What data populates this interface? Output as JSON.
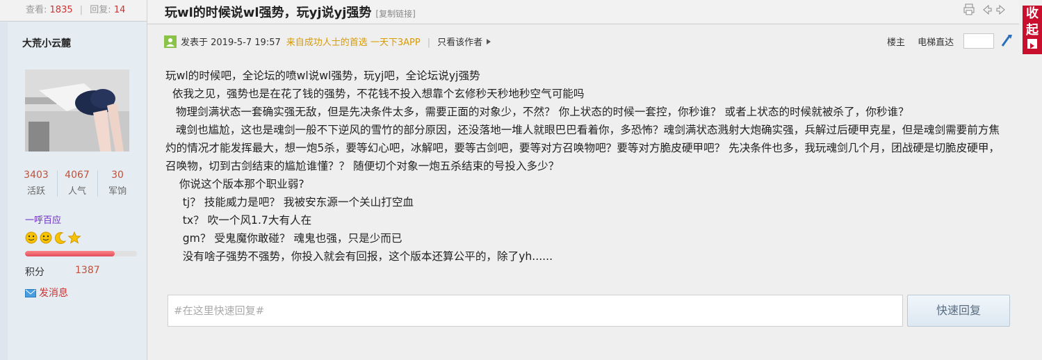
{
  "left_header": {
    "views_label": "查看:",
    "views_value": "1835",
    "replies_label": "回复:",
    "replies_value": "14"
  },
  "author": {
    "name": "大荒小云麓",
    "stats": [
      {
        "value": "3403",
        "label": "活跃"
      },
      {
        "value": "4067",
        "label": "人气"
      },
      {
        "value": "30",
        "label": "军饷"
      }
    ],
    "group": "一呼百应",
    "medals": [
      "sun-face-icon",
      "sun-face-icon",
      "moon-icon",
      "star-icon"
    ],
    "level_progress": 0.8,
    "credit_label": "积分",
    "credit_value": "1387",
    "message_label": "发消息"
  },
  "topic": {
    "title": "玩wl的时候说wl强势，玩yj说yj强势",
    "copy_link": "[复制链接]",
    "collapse_label_1": "收",
    "collapse_label_2": "起"
  },
  "post_meta": {
    "posted_at": "发表于 2019-5-7 19:57",
    "source": "来自成功人士的首选 一天下3APP",
    "only_author": "只看该作者",
    "floor_label": "楼主",
    "elevator_label": "电梯直达",
    "floor_input_value": ""
  },
  "post": {
    "lines": [
      "玩wl的时候吧，全论坛的喷wl说wl强势，玩yj吧，全论坛说yj强势",
      "  依我之见，强势也是在花了钱的强势，不花钱不投入想靠个玄修秒天秒地秒空气可能吗",
      "   物理剑满状态一套确实强无敌，但是先决条件太多，需要正面的对象少，不然？ 你上状态的时候一套控，你秒谁？ 或者上状态的时候就被杀了，你秒谁？",
      "   魂剑也尴尬，这也是魂剑一般不下逆风的雪竹的部分原因，还没落地一堆人就眼巴巴看着你，多恐怖？魂剑满状态溅射大炮确实强，兵解过后硬甲克星，但是魂剑需要前方焦灼的情况才能发挥最大，想一炮5杀，要等幻心吧，冰解吧，要等古剑吧，要等对方召唤物吧？要等对方脆皮硬甲吧？ 先决条件也多，我玩魂剑几个月，团战硬是切脆皮硬甲，召唤物，切到古剑结束的尴尬谁懂？？ 随便切个对象一炮五杀结束的号投入多少？",
      "    你说这个版本那个职业弱?",
      "     tj？ 技能威力是吧？ 我被安东源一个关山打空血",
      "     tx？ 吹一个风1.7大有人在",
      "     gm？ 受鬼魔你敢碰？ 魂鬼也强，只是少而已",
      "     没有啥子强势不强势，你投入就会有回报，这个版本还算公平的，除了yh......"
    ]
  },
  "quick_reply": {
    "placeholder": "#在这里快速回复#",
    "button_label": "快速回复"
  }
}
